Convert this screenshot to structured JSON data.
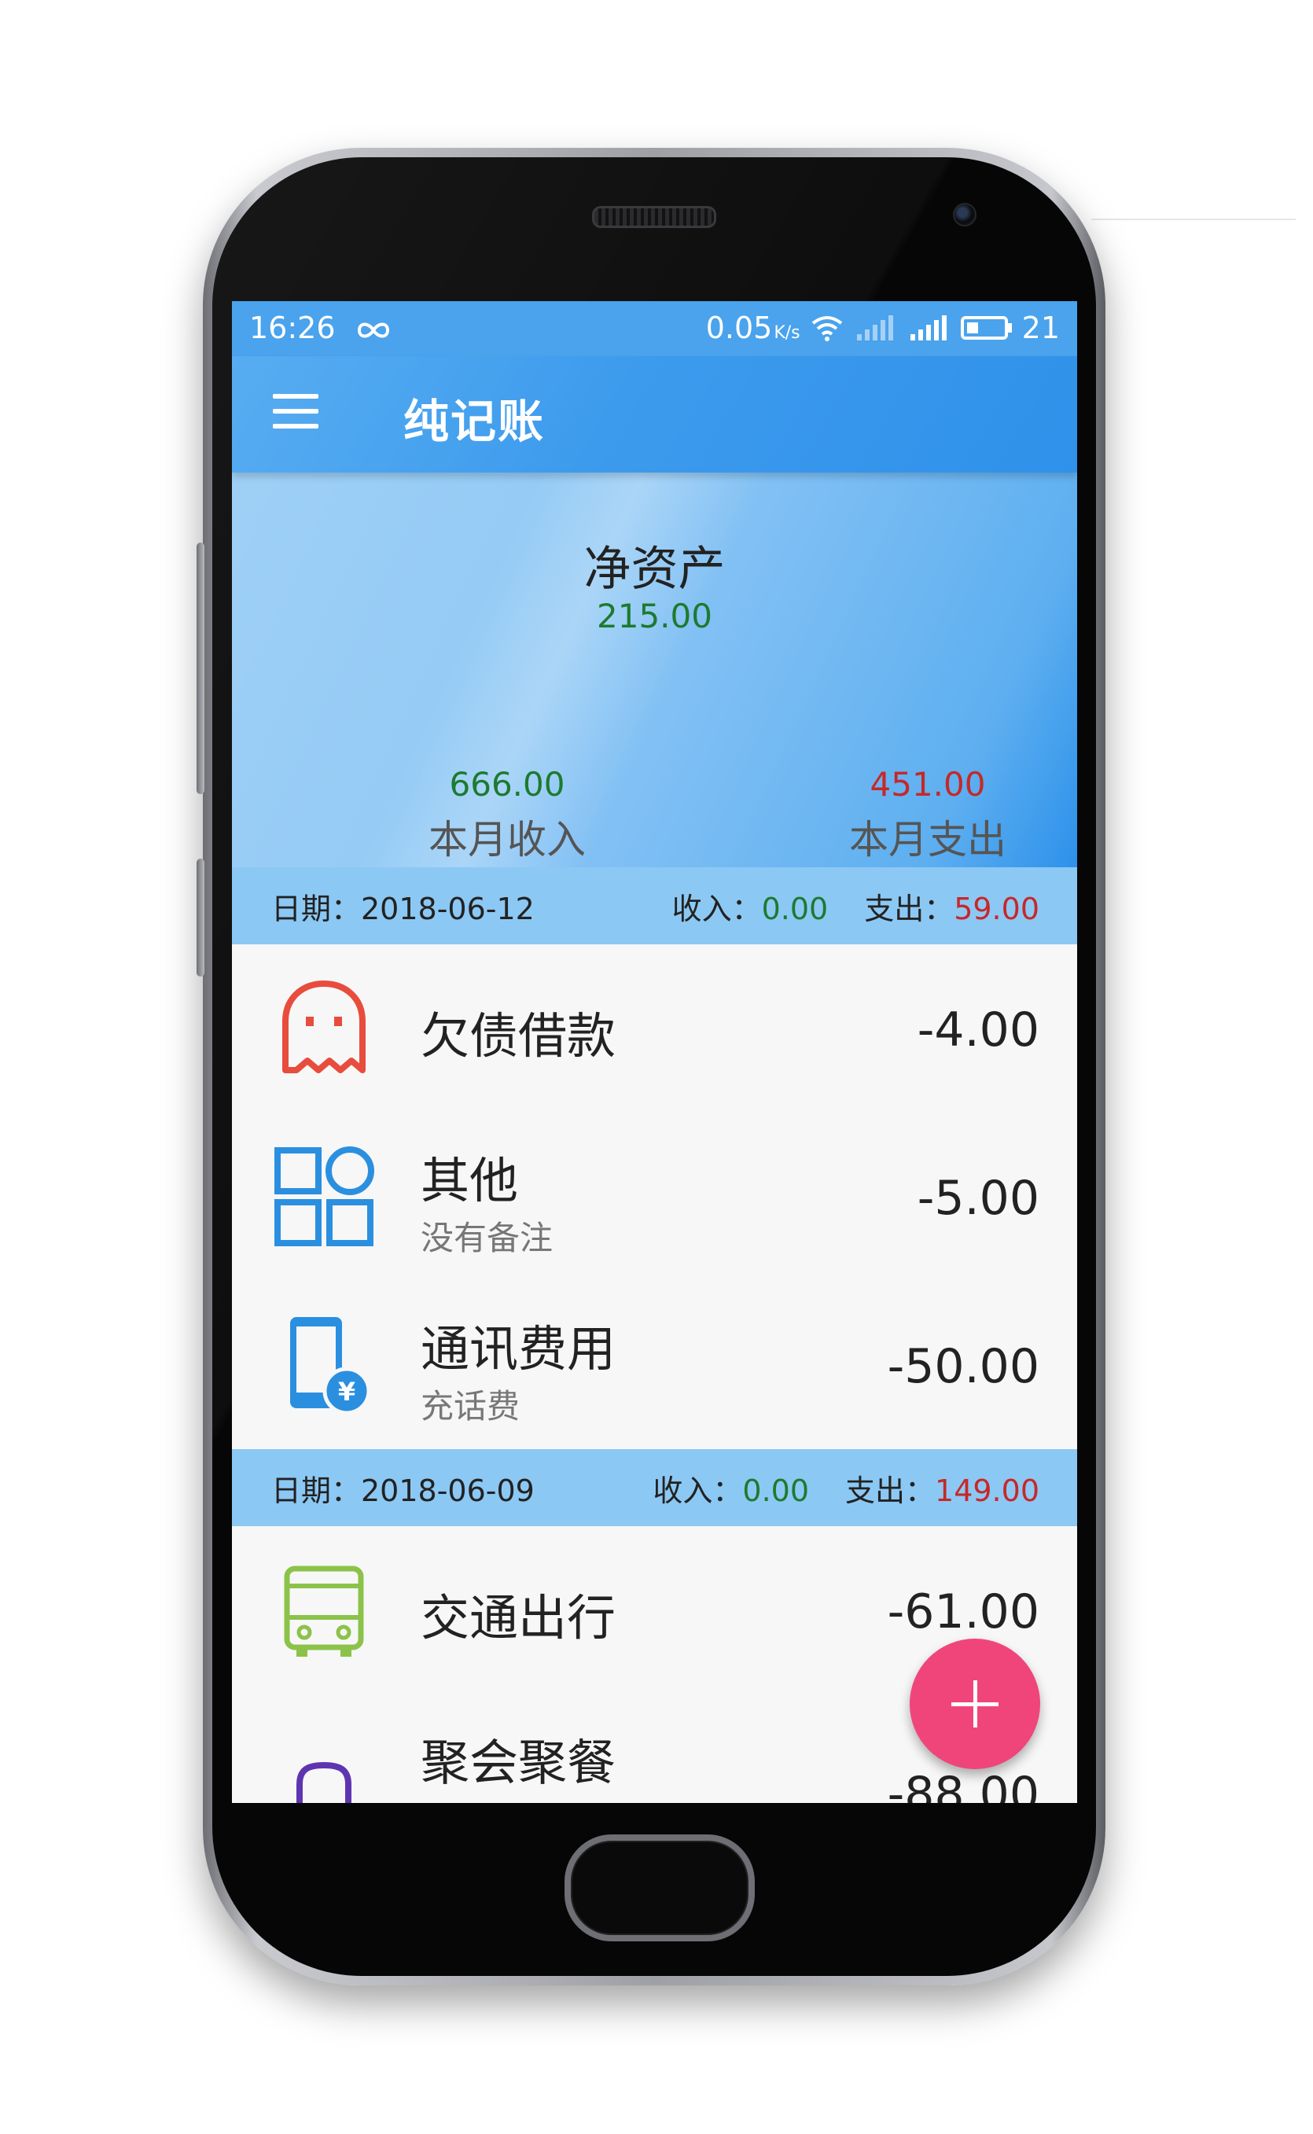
{
  "status_bar": {
    "time": "16:26",
    "link_icon": "infinity-icon",
    "net_speed": "0.05",
    "net_speed_unit": "K/s",
    "battery": "21"
  },
  "toolbar": {
    "title": "纯记账",
    "menu_icon": "hamburger-menu-icon"
  },
  "summary": {
    "net_assets_label": "净资产",
    "net_assets_value": "215.00",
    "income_value": "666.00",
    "income_label": "本月收入",
    "expense_value": "451.00",
    "expense_label": "本月支出"
  },
  "groups": [
    {
      "date_label": "日期：2018-06-12",
      "income_label": "收入：",
      "income_value": "0.00",
      "expense_label": "支出：",
      "expense_value": "59.00",
      "items": [
        {
          "title": "欠债借款",
          "note": "",
          "amount": "-4.00",
          "icon": "ghost-icon",
          "icon_color": "#e84c3d"
        },
        {
          "title": "其他",
          "note": "没有备注",
          "amount": "-5.00",
          "icon": "grid-shapes-icon",
          "icon_color": "#2b8fe0"
        },
        {
          "title": "通讯费用",
          "note": "充话费",
          "amount": "-50.00",
          "icon": "phone-yuan-icon",
          "icon_color": "#2b8fe0"
        }
      ]
    },
    {
      "date_label": "日期：2018-06-09",
      "income_label": "收入：",
      "income_value": "0.00",
      "expense_label": "支出：",
      "expense_value": "149.00",
      "items": [
        {
          "title": "交通出行",
          "note": "",
          "amount": "-61.00",
          "icon": "bus-icon",
          "icon_color": "#8bc34a"
        },
        {
          "title": "聚会聚餐",
          "note": "",
          "amount": "-88.00",
          "icon": "hat-icon",
          "icon_color": "#5e35b1"
        }
      ]
    }
  ],
  "fab": {
    "icon": "plus-icon",
    "color": "#f0457b"
  }
}
